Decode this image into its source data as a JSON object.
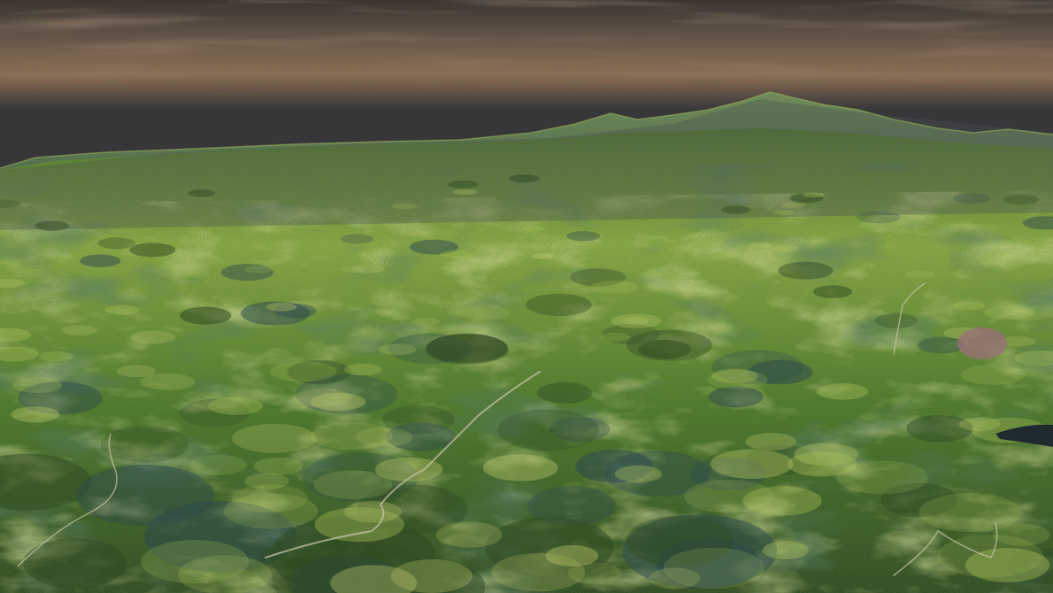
{
  "scene": {
    "subject": "aerial-terrain-render",
    "colors": {
      "sky_top": "#3a3532",
      "sky_mid": "#6b5a4a",
      "sky_glow": "#8a6e55",
      "sky_horizon": "#37373a",
      "haze": "#4a4f52",
      "mountain_far": "#6f8a5a",
      "mountain_far_shade": "#3f5a44",
      "forest_dark": "#2f4a22",
      "forest_mid": "#4f7a2c",
      "grass_light": "#8fae46",
      "grass_bright": "#a6bf5a",
      "meadow_yellow": "#b9c66a",
      "shadow_blue": "#2e4a4e",
      "path": "#c9c6a8",
      "soil_pink": "#9a6f7a",
      "water": "#1f2a2e"
    }
  }
}
